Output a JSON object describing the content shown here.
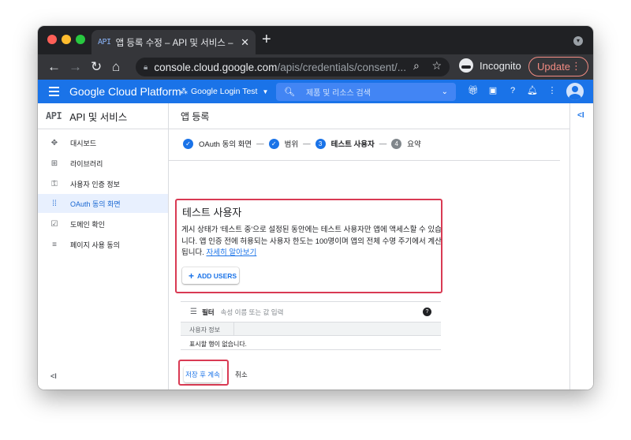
{
  "browser": {
    "tab_icon_text": "API",
    "tab_title": "앱 등록 수정 – API 및 서비스 – Goo",
    "tab_close": "✕",
    "new_tab": "+",
    "url_host": "console.cloud.google.com",
    "url_path": "/apis/credentials/consent/...",
    "incognito_label": "Incognito",
    "update_label": "Update"
  },
  "gcp_header": {
    "brand": "Google Cloud Platform",
    "project": "Google Login Test",
    "search_placeholder": "제품 및 리소스 검색"
  },
  "sidebar": {
    "logo": "API",
    "title": "API 및 서비스",
    "items": [
      {
        "label": "대시보드",
        "icon": "dashboard-icon",
        "glyph": "✥"
      },
      {
        "label": "라이브러리",
        "icon": "library-icon",
        "glyph": "⊞"
      },
      {
        "label": "사용자 인증 정보",
        "icon": "key-icon",
        "glyph": "⚿"
      },
      {
        "label": "OAuth 동의 화면",
        "icon": "oauth-icon",
        "glyph": "⁞⁞"
      },
      {
        "label": "도메인 확인",
        "icon": "domain-check-icon",
        "glyph": "☑"
      },
      {
        "label": "페이지 사용 동의",
        "icon": "settings-list-icon",
        "glyph": "≡"
      }
    ],
    "collapse": "<I"
  },
  "main": {
    "page_title": "앱 등록",
    "steps": [
      {
        "label": "OAuth 동의 화면",
        "state": "done"
      },
      {
        "label": "범위",
        "state": "done"
      },
      {
        "label": "테스트 사용자",
        "state": "current",
        "number": "3"
      },
      {
        "label": "요약",
        "state": "pending",
        "number": "4"
      }
    ],
    "step_separator": "—",
    "section_title": "테스트 사용자",
    "description": "게시 상태가 '테스트 중'으로 설정된 동안에는 테스트 사용자만 앱에 액세스할 수 있습니다. 앱 인증 전에 허용되는 사용자 한도는 100명이며 앱의 전체 수명 주기에서 계산됩니다.",
    "learn_more": "자세히 알아보기",
    "add_users": "ADD USERS",
    "filter_label": "필터",
    "filter_placeholder": "속성 이름 또는 값 입력",
    "table_header": "사용자 정보",
    "table_empty": "표시할 행이 없습니다.",
    "save_continue": "저장 후 계속",
    "cancel": "취소"
  },
  "rightpanel": {
    "toggle": "<I"
  },
  "colors": {
    "accent": "#1a73e8",
    "highlight": "#d93a53",
    "active_bg": "#e8f0fe"
  }
}
